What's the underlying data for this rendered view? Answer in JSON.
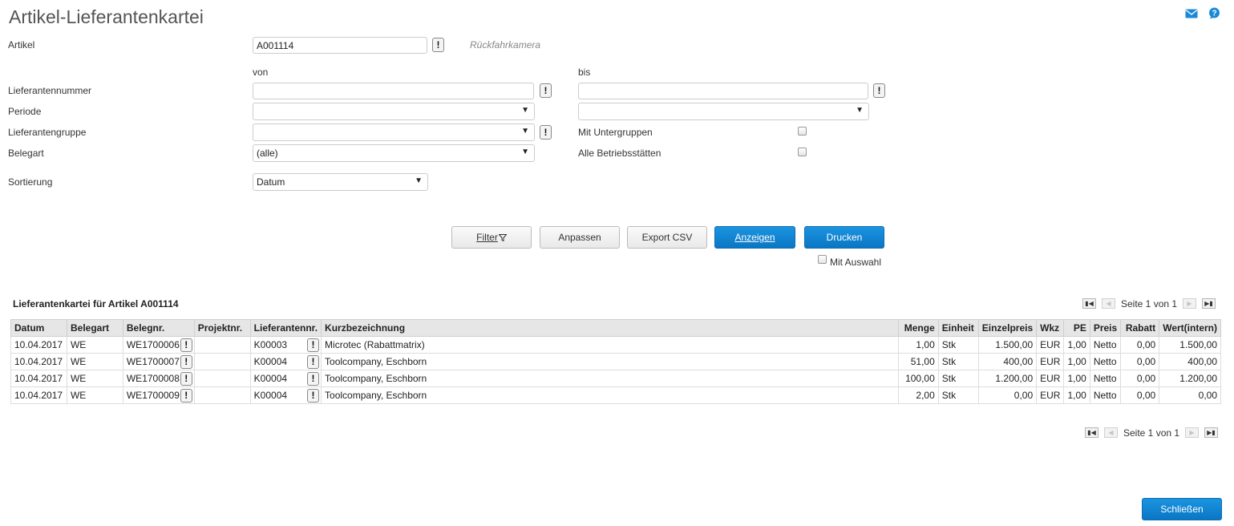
{
  "page": {
    "title": "Artikel-Lieferantenkartei"
  },
  "icons": {
    "mail": "mail-icon",
    "help": "help-icon",
    "accent": "#1a8ad6"
  },
  "form": {
    "artikel_label": "Artikel",
    "artikel_value": "A001114",
    "artikel_desc": "Rückfahrkamera",
    "von": "von",
    "bis": "bis",
    "lieferantennummer_label": "Lieferantennummer",
    "periode_label": "Periode",
    "lieferantengruppe_label": "Lieferantengruppe",
    "belegart_label": "Belegart",
    "belegart_value": "(alle)",
    "mit_untergruppen_label": "Mit Untergruppen",
    "alle_betriebsstaetten_label": "Alle Betriebsstätten",
    "sortierung_label": "Sortierung",
    "sortierung_value": "Datum",
    "excl": "!",
    "arrow": "▼"
  },
  "buttons": {
    "filter": "Filter",
    "filter_icon": "funnel-icon",
    "anpassen": "Anpassen",
    "export_csv": "Export CSV",
    "anzeigen": "Anzeigen",
    "drucken": "Drucken",
    "mit_auswahl": "Mit Auswahl",
    "schliessen": "Schließen",
    "primary_color": "#0a80d0"
  },
  "table": {
    "title": "Lieferantenkartei für Artikel A001114",
    "pager": "Seite 1 von 1",
    "columns": [
      "Datum",
      "Belegart",
      "Belegnr.",
      "Projektnr.",
      "Lieferantennr.",
      "Kurzbezeichnung",
      "Menge",
      "Einheit",
      "Einzelpreis",
      "Wkz",
      "PE",
      "Preis",
      "Rabatt",
      "Wert(intern)"
    ],
    "rows": [
      {
        "datum": "10.04.2017",
        "belegart": "WE",
        "belegnr": "WE1700006",
        "projektnr": "",
        "lieferantennr": "K00003",
        "kurz": "Microtec (Rabattmatrix)",
        "menge": "1,00",
        "einheit": "Stk",
        "einzelpreis": "1.500,00",
        "wkz": "EUR",
        "pe": "1,00",
        "preis": "Netto",
        "rabatt": "0,00",
        "wert": "1.500,00"
      },
      {
        "datum": "10.04.2017",
        "belegart": "WE",
        "belegnr": "WE1700007",
        "projektnr": "",
        "lieferantennr": "K00004",
        "kurz": "Toolcompany, Eschborn",
        "menge": "51,00",
        "einheit": "Stk",
        "einzelpreis": "400,00",
        "wkz": "EUR",
        "pe": "1,00",
        "preis": "Netto",
        "rabatt": "0,00",
        "wert": "400,00"
      },
      {
        "datum": "10.04.2017",
        "belegart": "WE",
        "belegnr": "WE1700008",
        "projektnr": "",
        "lieferantennr": "K00004",
        "kurz": "Toolcompany, Eschborn",
        "menge": "100,00",
        "einheit": "Stk",
        "einzelpreis": "1.200,00",
        "wkz": "EUR",
        "pe": "1,00",
        "preis": "Netto",
        "rabatt": "0,00",
        "wert": "1.200,00"
      },
      {
        "datum": "10.04.2017",
        "belegart": "WE",
        "belegnr": "WE1700009",
        "projektnr": "",
        "lieferantennr": "K00004",
        "kurz": "Toolcompany, Eschborn",
        "menge": "2,00",
        "einheit": "Stk",
        "einzelpreis": "0,00",
        "wkz": "EUR",
        "pe": "1,00",
        "preis": "Netto",
        "rabatt": "0,00",
        "wert": "0,00"
      }
    ]
  }
}
